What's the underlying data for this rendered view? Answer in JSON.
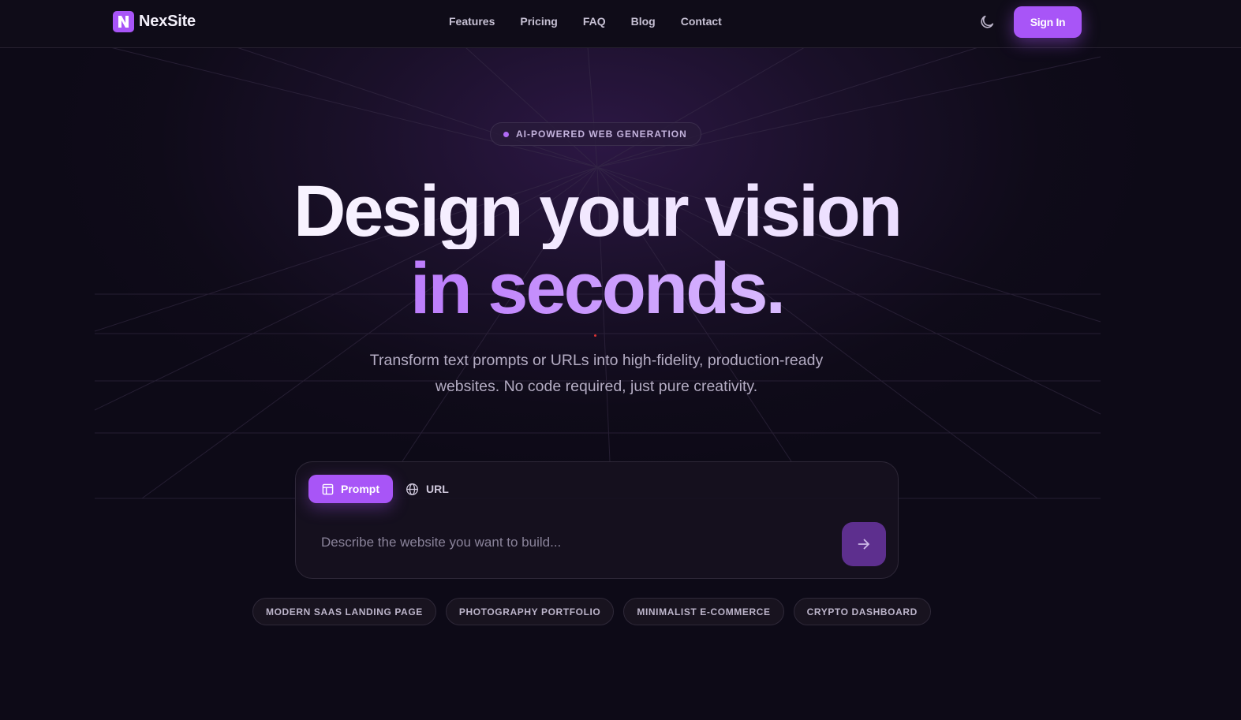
{
  "brand": {
    "name": "NexSite",
    "accent": "#a855f7",
    "background": "#0d0a17"
  },
  "nav": {
    "links": [
      "Features",
      "Pricing",
      "FAQ",
      "Blog",
      "Contact"
    ],
    "theme_icon": "moon-icon",
    "signin_label": "Sign In"
  },
  "hero": {
    "badge": "AI-POWERED WEB GENERATION",
    "headline_line1": "Design your vision",
    "headline_line2": "in seconds.",
    "subtitle_line1": "Transform text prompts or URLs into high-fidelity, production-ready",
    "subtitle_line2": "websites. No code required, just pure creativity."
  },
  "prompt_card": {
    "tabs": [
      {
        "label": "Prompt",
        "icon": "layout-icon",
        "active": true
      },
      {
        "label": "URL",
        "icon": "globe-icon",
        "active": false
      }
    ],
    "placeholder": "Describe the website you want to build...",
    "submit_icon": "arrow-right-icon"
  },
  "suggestions": [
    "MODERN SAAS LANDING PAGE",
    "PHOTOGRAPHY PORTFOLIO",
    "MINIMALIST E-COMMERCE",
    "CRYPTO DASHBOARD"
  ]
}
